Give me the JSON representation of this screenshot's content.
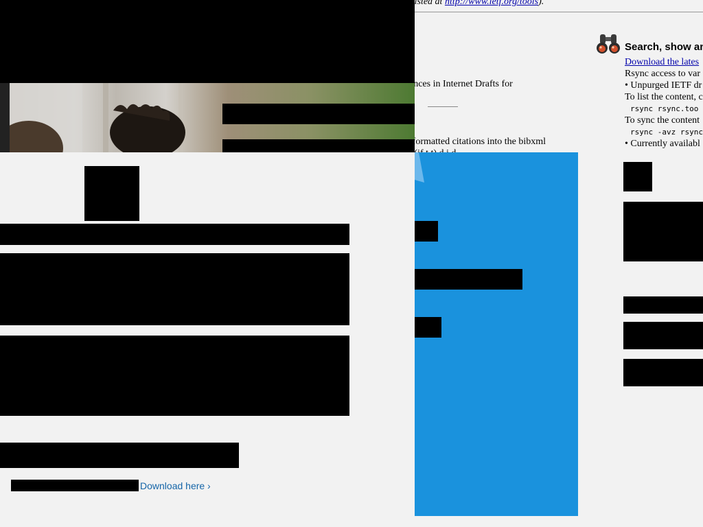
{
  "background_page": {
    "top_note": {
      "prefix": "e listed at ",
      "link": "http://www.ietf.org/tools",
      "suffix": ")."
    },
    "body_lines": [
      "ences in Internet Drafts for",
      ".",
      "-formatted citations into the bibxml",
      "l    (if    t    t)    d    i    d"
    ],
    "search": {
      "heading": "Search, show an",
      "download_link": "Download the lates",
      "rsync_intro": "Rsync access to var",
      "bullet_unpurged": "• Unpurged IETF dr",
      "list_intro": "To list the content, c",
      "list_cmd": "rsync rsync.too",
      "sync_intro": "To sync the content",
      "sync_cmd": "rsync -avz rsync",
      "bullet_available": "• Currently availabl"
    }
  },
  "overlay": {
    "download_label": "Download here ›"
  },
  "colors": {
    "page_background": "#f2f2f2",
    "panel_blue": "#1a92dd",
    "link_blue": "#1565a8",
    "legacy_link": "#0000aa",
    "redaction": "#000000"
  },
  "icons": {
    "search": "binoculars-icon",
    "download": "chevron-right-icon"
  }
}
